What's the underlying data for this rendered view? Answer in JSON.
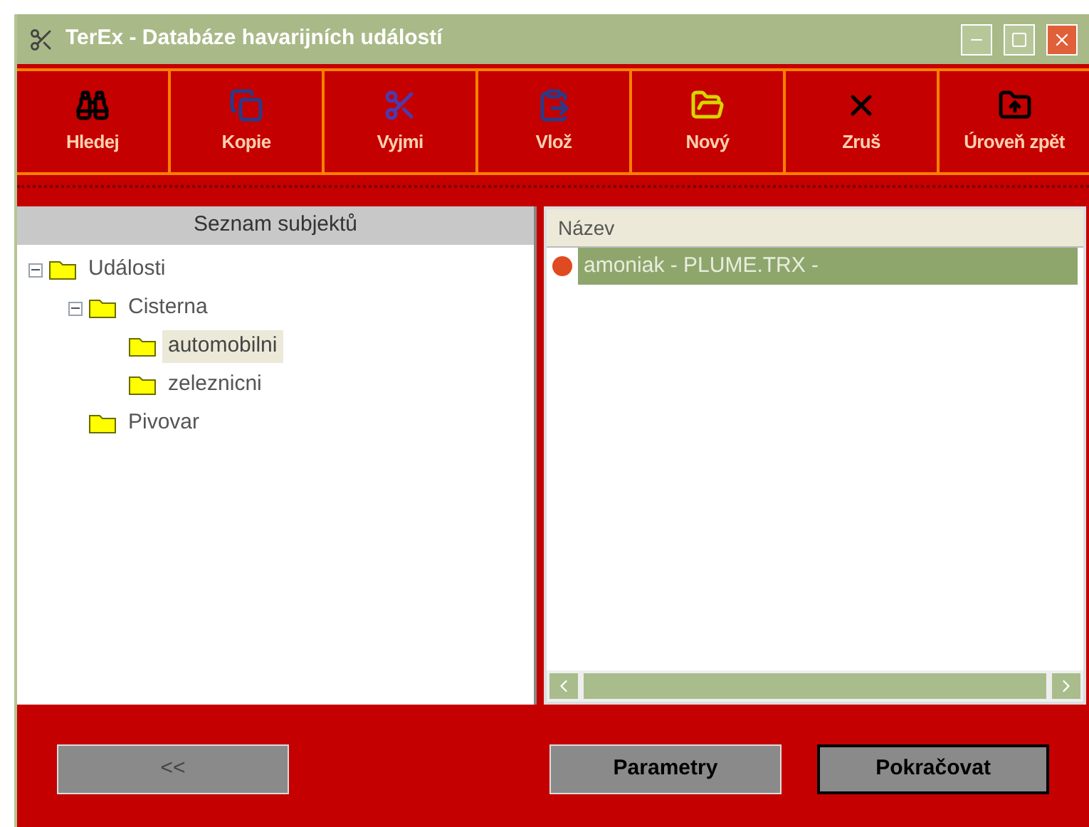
{
  "window": {
    "title": "TerEx - Databáze havarijních událostí"
  },
  "toolbar": [
    {
      "kind": "search",
      "label": "Hledej"
    },
    {
      "kind": "copy",
      "label": "Kopie"
    },
    {
      "kind": "cut",
      "label": "Vyjmi"
    },
    {
      "kind": "paste",
      "label": "Vlož"
    },
    {
      "kind": "new",
      "label": "Nový"
    },
    {
      "kind": "delete",
      "label": "Zruš"
    },
    {
      "kind": "up",
      "label": "Úroveň zpět"
    }
  ],
  "tree": {
    "title": "Seznam subjektů",
    "items": [
      {
        "label": "Události",
        "expanded": true,
        "selected": false,
        "children": [
          {
            "label": "Cisterna",
            "expanded": true,
            "selected": false,
            "children": [
              {
                "label": "automobilni",
                "selected": true
              },
              {
                "label": "zeleznicni",
                "selected": false
              }
            ]
          },
          {
            "label": "Pivovar",
            "selected": false
          }
        ]
      }
    ]
  },
  "list": {
    "column": "Název",
    "rows": [
      {
        "label": "amoniak - PLUME.TRX -",
        "selected": true
      }
    ]
  },
  "buttons": [
    {
      "label": "<<",
      "disabled": true,
      "default": false
    },
    {
      "label": "Parametry",
      "disabled": false,
      "default": false
    },
    {
      "label": "Pokračovat",
      "disabled": false,
      "default": true
    }
  ]
}
